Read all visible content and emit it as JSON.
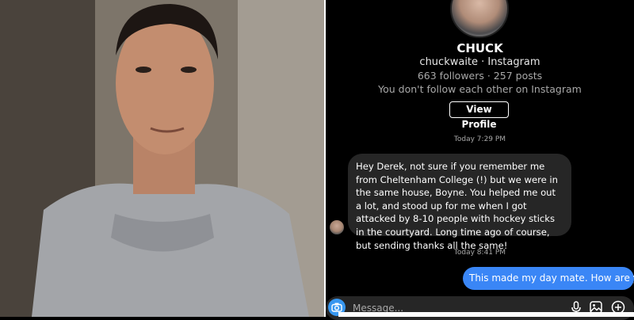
{
  "profile": {
    "name": "CHUCK",
    "handle": "chuckwaite · Instagram",
    "stats": "663 followers · 257 posts",
    "follow_note": "You don't follow each other on Instagram",
    "view_profile_label": "View Profile"
  },
  "thread": {
    "timestamp_1": "Today 7:29 PM",
    "incoming_message": "Hey Derek, not sure if you remember me from Cheltenham College (!) but we were in the same house, Boyne. You helped me out a lot, and stood up for me when I got attacked by 8-10 people with hockey sticks in the courtyard. Long time ago of course, but sending thanks all the same!",
    "timestamp_2": "Today 8:41 PM",
    "outgoing_message": "This made my day mate. How are you?"
  },
  "composer": {
    "placeholder": "Message..."
  },
  "icons": [
    "camera-icon",
    "microphone-icon",
    "gallery-icon",
    "plus-icon"
  ],
  "colors": {
    "background": "#000000",
    "incoming_bubble": "#262626",
    "outgoing_bubble": "#3a86f6",
    "camera_button": "#3797f0",
    "muted_text": "#a8a8a8"
  }
}
